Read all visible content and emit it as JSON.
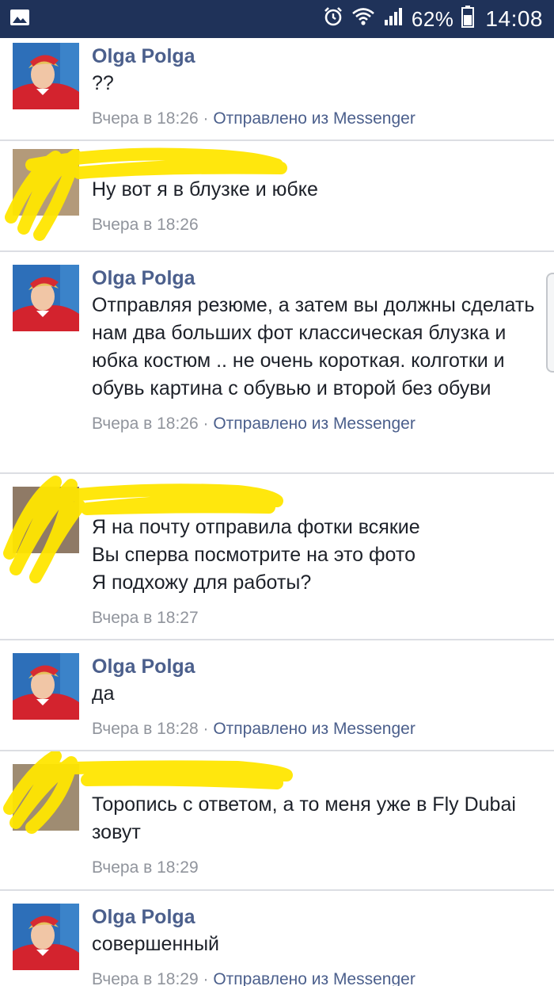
{
  "status_bar": {
    "battery_percent": "62%",
    "time": "14:08",
    "icons": [
      "gallery-icon",
      "alarm-icon",
      "wifi-icon",
      "signal-icon",
      "battery-icon"
    ]
  },
  "messages": [
    {
      "sender": "Olga Polga",
      "text": "??",
      "time": "Вчера в 18:26",
      "via": "Отправлено из Messenger",
      "redacted": false
    },
    {
      "sender": "",
      "text": "Ну вот я в блузке и юбке",
      "time": "Вчера в 18:26",
      "via": "",
      "redacted": true
    },
    {
      "sender": "Olga Polga",
      "text": "Отправляя резюме, а затем вы должны сделать нам два больших фот классическая блузка и юбка костюм .. не очень короткая. колготки и обувь картина с обувью и второй без обуви",
      "time": "Вчера в 18:26",
      "via": "Отправлено из Messenger",
      "redacted": false
    },
    {
      "sender": "",
      "text": "Я на почту отправила фотки всякие\nВы сперва посмотрите на это фото\nЯ подхожу для работы?",
      "time": "Вчера в 18:27",
      "via": "",
      "redacted": true
    },
    {
      "sender": "Olga Polga",
      "text": "да",
      "time": "Вчера в 18:28",
      "via": "Отправлено из Messenger",
      "redacted": false
    },
    {
      "sender": "",
      "text": "Торопись с ответом, а то меня уже в Fly Dubai зовут",
      "time": "Вчера в 18:29",
      "via": "",
      "redacted": true
    },
    {
      "sender": "Olga Polga",
      "text": "совершенный",
      "time": "Вчера в 18:29",
      "via": "Отправлено из Messenger",
      "redacted": false
    }
  ],
  "colors": {
    "status_bar": "#1f3259",
    "sender_name": "#4b5f8c",
    "message_text": "#1d2129",
    "meta_text": "#90949c",
    "separator": "#dcdee3",
    "scribble": "#ffe600"
  }
}
